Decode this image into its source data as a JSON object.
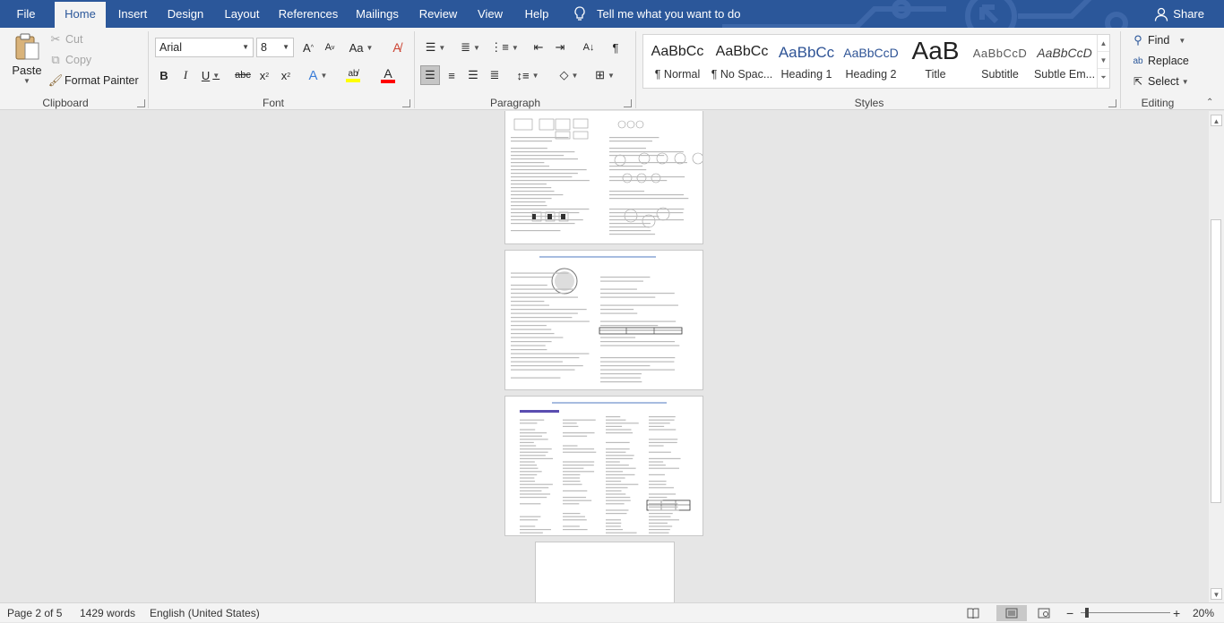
{
  "menu": {
    "tabs": [
      "File",
      "Home",
      "Insert",
      "Design",
      "Layout",
      "References",
      "Mailings",
      "Review",
      "View",
      "Help"
    ],
    "active": "Home",
    "tell_me": "Tell me what you want to do",
    "share": "Share"
  },
  "clipboard": {
    "paste": "Paste",
    "cut": "Cut",
    "copy": "Copy",
    "format_painter": "Format Painter",
    "label": "Clipboard"
  },
  "font": {
    "name": "Arial",
    "size": "8",
    "label": "Font",
    "highlight_color": "#ffff00",
    "font_color": "#ff0000"
  },
  "paragraph": {
    "label": "Paragraph"
  },
  "styles": {
    "items": [
      {
        "preview": "AaBbCc",
        "name": "¶ Normal"
      },
      {
        "preview": "AaBbCc",
        "name": "¶ No Spac..."
      },
      {
        "preview": "AaBbCc",
        "name": "Heading 1"
      },
      {
        "preview": "AaBbCcD",
        "name": "Heading 2"
      },
      {
        "preview": "AaB",
        "name": "Title"
      },
      {
        "preview": "AaBbCcD",
        "name": "Subtitle"
      },
      {
        "preview": "AaBbCcD",
        "name": "Subtle Em..."
      }
    ],
    "label": "Styles"
  },
  "editing": {
    "find": "Find",
    "replace": "Replace",
    "select": "Select",
    "label": "Editing"
  },
  "status": {
    "page": "Page 2 of 5",
    "words": "1429 words",
    "language": "English (United States)",
    "zoom": "20%"
  },
  "colors": {
    "title_bar": "#2b579a",
    "ribbon": "#f3f3f3",
    "document_background": "#e6e6e6"
  }
}
